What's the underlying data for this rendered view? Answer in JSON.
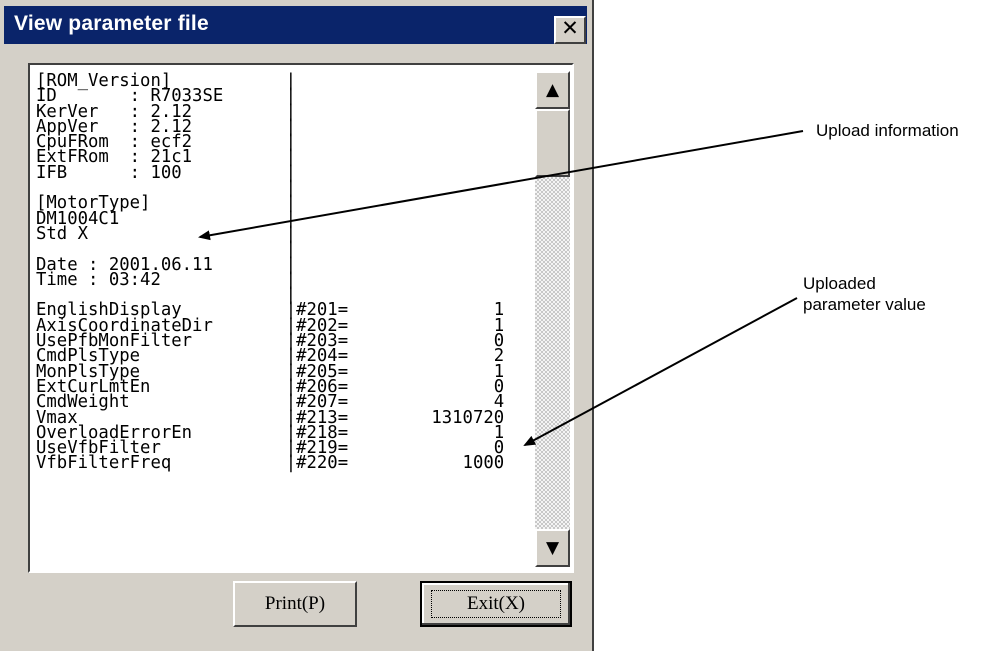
{
  "window": {
    "title": "View parameter file",
    "close_glyph": "✕"
  },
  "content": {
    "rom_section": [
      "[ROM_Version]           |",
      "ID       : R7033SE      |",
      "KerVer   : 2.12         |",
      "AppVer   : 2.12         |",
      "CpuFRom  : ecf2         |",
      "ExtFRom  : 21c1         |",
      "IFB      : 100          |"
    ],
    "motor_section": [
      "[MotorType]             |",
      "DM1004C1                |",
      "Std X                   |"
    ],
    "date_section": [
      "Date : 2001.06.11       |",
      "Time : 03:42            |"
    ],
    "parameters": [
      {
        "name": "EnglishDisplay",
        "id": "#201=",
        "value": "1"
      },
      {
        "name": "AxisCoordinateDir",
        "id": "#202=",
        "value": "1"
      },
      {
        "name": "UsePfbMonFilter",
        "id": "#203=",
        "value": "0"
      },
      {
        "name": "CmdPlsType",
        "id": "#204=",
        "value": "2"
      },
      {
        "name": "MonPlsType",
        "id": "#205=",
        "value": "1"
      },
      {
        "name": "ExtCurLmtEn",
        "id": "#206=",
        "value": "0"
      },
      {
        "name": "CmdWeight",
        "id": "#207=",
        "value": "4"
      },
      {
        "name": "Vmax",
        "id": "#213=",
        "value": "1310720"
      },
      {
        "name": "OverloadErrorEn",
        "id": "#218=",
        "value": "1"
      },
      {
        "name": "UseVfbFilter",
        "id": "#219=",
        "value": "0"
      },
      {
        "name": "VfbFilterFreq",
        "id": "#220=",
        "value": "1000"
      }
    ]
  },
  "scrollbar": {
    "up_glyph": "▲",
    "down_glyph": "▼"
  },
  "buttons": {
    "print_label": "Print(P)",
    "exit_label": "Exit(X)"
  },
  "callouts": {
    "upload_info": "Upload information",
    "param_value_line1": "Uploaded",
    "param_value_line2": "parameter value"
  }
}
